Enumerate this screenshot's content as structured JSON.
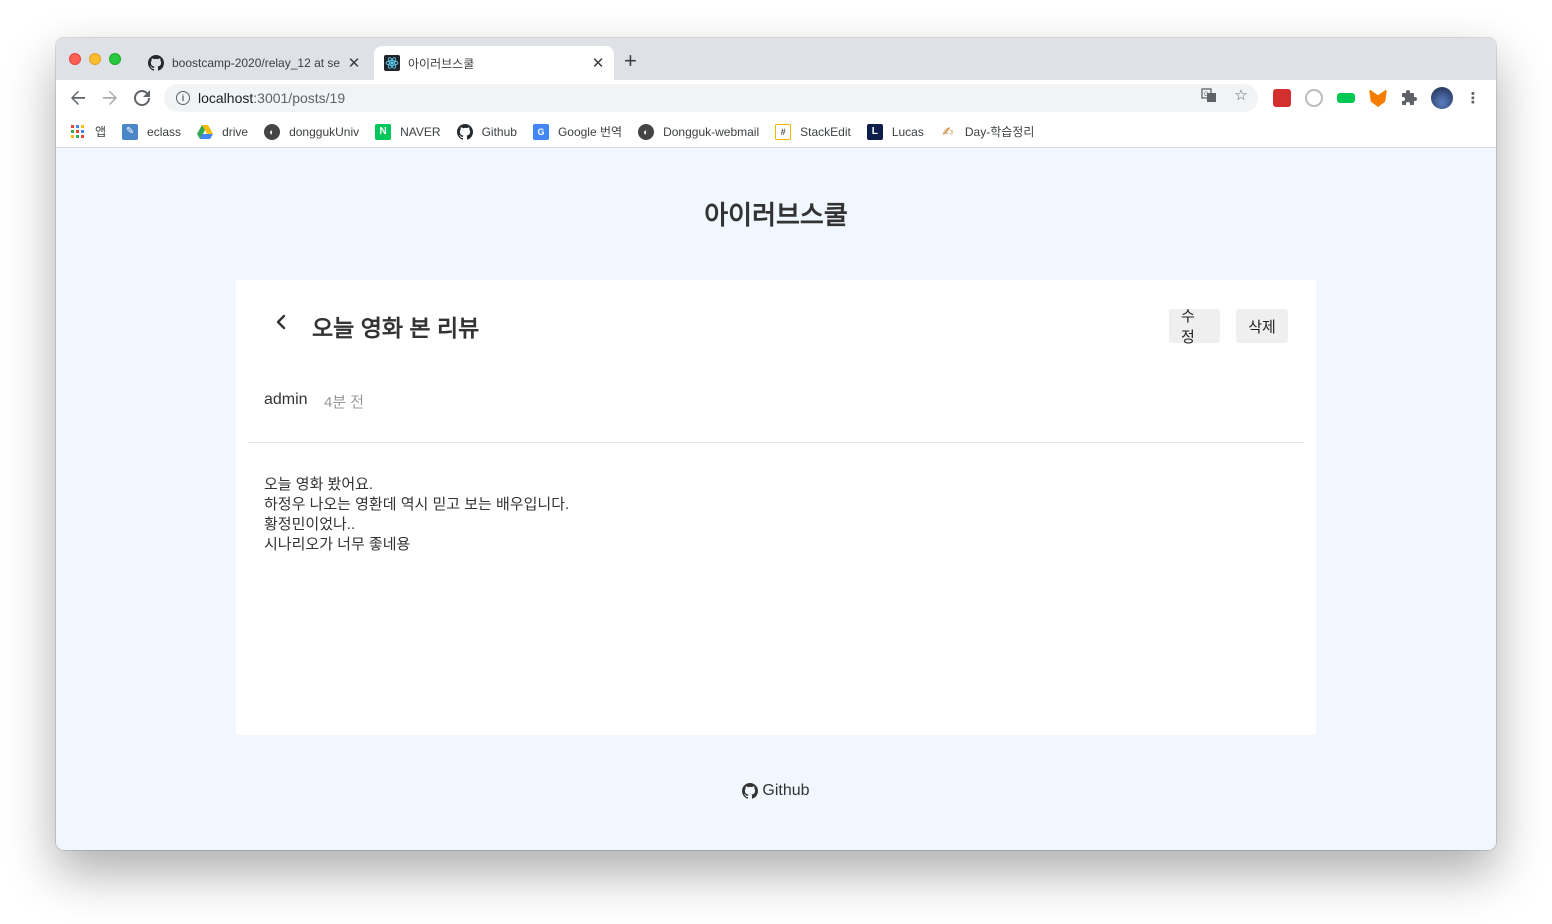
{
  "browser": {
    "tabs": [
      {
        "title": "boostcamp-2020/relay_12 at se",
        "favicon": "github-icon",
        "active": false
      },
      {
        "title": "아이러브스쿨",
        "favicon": "react-icon",
        "active": true
      }
    ],
    "url": {
      "host": "localhost",
      "path": ":3001/posts/19"
    },
    "bookmarks": [
      {
        "label": "앱",
        "icon": "apps-grid-icon"
      },
      {
        "label": "eclass",
        "icon": "eclass-icon"
      },
      {
        "label": "drive",
        "icon": "drive-icon"
      },
      {
        "label": "donggukUniv",
        "icon": "globe-icon"
      },
      {
        "label": "NAVER",
        "icon": "naver-icon"
      },
      {
        "label": "Github",
        "icon": "github-icon"
      },
      {
        "label": "Google 번역",
        "icon": "google-translate-icon"
      },
      {
        "label": "Dongguk-webmail",
        "icon": "globe-icon"
      },
      {
        "label": "StackEdit",
        "icon": "stackedit-icon"
      },
      {
        "label": "Lucas",
        "icon": "lucas-icon"
      },
      {
        "label": "Day-학습정리",
        "icon": "pen-icon"
      }
    ]
  },
  "site": {
    "title": "아이러브스쿨"
  },
  "post": {
    "title": "오늘 영화 본 리뷰",
    "edit_label": "수정",
    "delete_label": "삭제",
    "author": "admin",
    "time": "4분 전",
    "body": [
      "오늘 영화 봤어요.",
      "하정우 나오는 영환데 역시 믿고 보는 배우입니다.",
      "황정민이었나..",
      "시나리오가 너무 좋네용"
    ]
  },
  "footer": {
    "link_label": "Github",
    "icon": "github-icon"
  },
  "colors": {
    "page_bg": "#f0f7ff",
    "card_bg": "#ffffff",
    "button_bg": "#efefef"
  }
}
